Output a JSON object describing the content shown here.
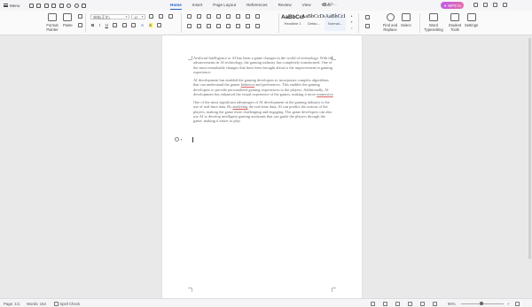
{
  "topbar": {
    "menu_label": "Menu",
    "tabs": [
      {
        "label": "Home",
        "active": true
      },
      {
        "label": "Insert"
      },
      {
        "label": "Page Layout"
      },
      {
        "label": "References"
      },
      {
        "label": "Review"
      },
      {
        "label": "View"
      },
      {
        "label": "Tools"
      }
    ],
    "search_placeholder": "Fin...",
    "ai_button_label": "WPS AI"
  },
  "ribbon": {
    "format_painter_label": "Format Painter",
    "paste_label": "Paste",
    "font_name": "宋体(正文)",
    "font_size": "12",
    "bold": "B",
    "italic": "I",
    "underline": "U",
    "styles": [
      {
        "sample": "AaBbCcI",
        "name": "Headline 1"
      },
      {
        "sample": "AaBbCcDd",
        "name": "Defau..."
      },
      {
        "sample": "AaBbCcI",
        "name": "Normal..."
      }
    ],
    "find_replace_label": "Find and Replace",
    "select_label": "Select",
    "word_typesetting_label": "Word Typesetting",
    "student_tools_label": "Student Tools",
    "settings_label": "Settings"
  },
  "document": {
    "paragraphs": [
      "Artificial Intelligence or AI has been a game changer in the world of technology. With the advancements in AI technology, the gaming industry has completely transformed. One of the most remarkable changes that have been brought about is the improvement in gaming experience.",
      "AI development has enabled the gaming developers to incorporate complex algorithms that can understand the gamer behavior and preferences. This enables the gaming developers to provide personalized gaming experiences to the players. Additionally, AI development has enhanced the visual experience of the games, making it more immersive.",
      "One of the most significant advantages of AI development in the gaming industry is the use of real-time data. By analyzing the real-time data, AI can predict the actions of the players, making the game more challenging and engaging. The game developers can also use AI to develop intelligent gaming assistants that can guide the players through the game, making it easier to play."
    ]
  },
  "status": {
    "page": "Page: 1/1",
    "words": "Words: 154",
    "spell_check": "Spell Check",
    "zoom": "90%"
  },
  "colors": {
    "accent": "#2b61c7",
    "ai_gradient_start": "#c25bea",
    "ai_gradient_end": "#e46ea5"
  }
}
